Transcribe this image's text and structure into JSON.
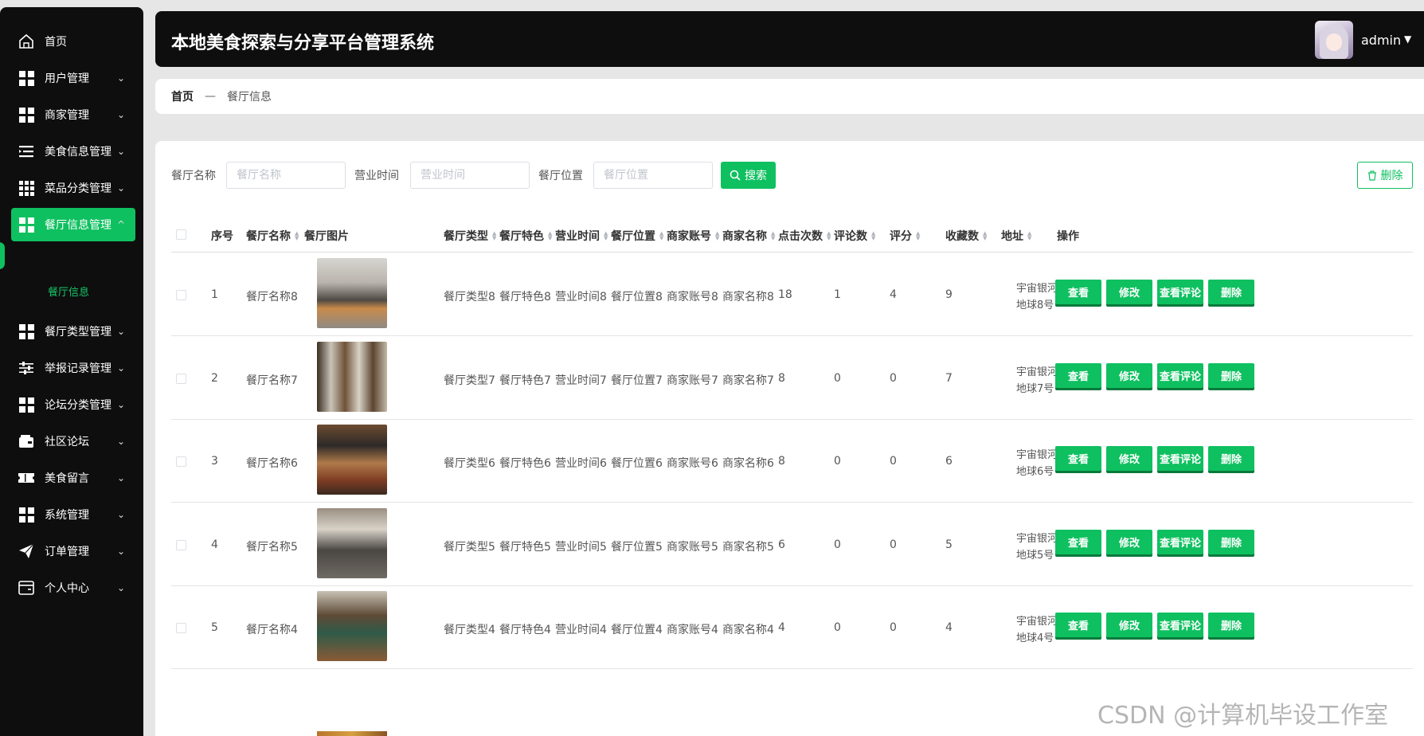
{
  "sidebar": {
    "items": [
      {
        "label": "首页",
        "icon": "home-icon"
      },
      {
        "label": "用户管理",
        "icon": "grid-icon"
      },
      {
        "label": "商家管理",
        "icon": "grid-icon"
      },
      {
        "label": "美食信息管理",
        "icon": "list-icon"
      },
      {
        "label": "菜品分类管理",
        "icon": "grid9-icon"
      },
      {
        "label": "餐厅信息管理",
        "icon": "grid-icon"
      },
      {
        "label": "餐厅类型管理",
        "icon": "grid-icon"
      },
      {
        "label": "举报记录管理",
        "icon": "sliders-icon"
      },
      {
        "label": "论坛分类管理",
        "icon": "grid-icon"
      },
      {
        "label": "社区论坛",
        "icon": "wallet-icon"
      },
      {
        "label": "美食留言",
        "icon": "ticket-icon"
      },
      {
        "label": "系统管理",
        "icon": "grid-icon"
      },
      {
        "label": "订单管理",
        "icon": "send-icon"
      },
      {
        "label": "个人中心",
        "icon": "card-icon"
      }
    ],
    "sub_item": "餐厅信息"
  },
  "header": {
    "title": "本地美食探索与分享平台管理系统",
    "user": "admin"
  },
  "breadcrumb": {
    "home": "首页",
    "sep": "—",
    "current": "餐厅信息"
  },
  "filters": {
    "name_label": "餐厅名称",
    "name_placeholder": "餐厅名称",
    "time_label": "营业时间",
    "time_placeholder": "营业时间",
    "location_label": "餐厅位置",
    "location_placeholder": "餐厅位置",
    "search_label": "搜索",
    "delete_label": "删除"
  },
  "table": {
    "headers": [
      "序号",
      "餐厅名称",
      "餐厅图片",
      "餐厅类型",
      "餐厅特色",
      "营业时间",
      "餐厅位置",
      "商家账号",
      "商家名称",
      "点击次数",
      "评论数",
      "评分",
      "收藏数",
      "地址",
      "操作"
    ],
    "actions": [
      "查看",
      "修改",
      "查看评论",
      "删除"
    ],
    "rows": [
      {
        "no": "1",
        "name": "餐厅名称8",
        "type": "餐厅类型8",
        "feature": "餐厅特色8",
        "time": "营业时间8",
        "location": "餐厅位置8",
        "account": "商家账号8",
        "merchant": "商家名称8",
        "clicks": "18",
        "comments": "1",
        "score": "4",
        "favorites": "9",
        "addr1": "宇宙银河系",
        "addr2": "地球8号"
      },
      {
        "no": "2",
        "name": "餐厅名称7",
        "type": "餐厅类型7",
        "feature": "餐厅特色7",
        "time": "营业时间7",
        "location": "餐厅位置7",
        "account": "商家账号7",
        "merchant": "商家名称7",
        "clicks": "8",
        "comments": "0",
        "score": "0",
        "favorites": "7",
        "addr1": "宇宙银河系",
        "addr2": "地球7号"
      },
      {
        "no": "3",
        "name": "餐厅名称6",
        "type": "餐厅类型6",
        "feature": "餐厅特色6",
        "time": "营业时间6",
        "location": "餐厅位置6",
        "account": "商家账号6",
        "merchant": "商家名称6",
        "clicks": "8",
        "comments": "0",
        "score": "0",
        "favorites": "6",
        "addr1": "宇宙银河系",
        "addr2": "地球6号"
      },
      {
        "no": "4",
        "name": "餐厅名称5",
        "type": "餐厅类型5",
        "feature": "餐厅特色5",
        "time": "营业时间5",
        "location": "餐厅位置5",
        "account": "商家账号5",
        "merchant": "商家名称5",
        "clicks": "6",
        "comments": "0",
        "score": "0",
        "favorites": "5",
        "addr1": "宇宙银河系",
        "addr2": "地球5号"
      },
      {
        "no": "5",
        "name": "餐厅名称4",
        "type": "餐厅类型4",
        "feature": "餐厅特色4",
        "time": "营业时间4",
        "location": "餐厅位置4",
        "account": "商家账号4",
        "merchant": "商家名称4",
        "clicks": "4",
        "comments": "0",
        "score": "0",
        "favorites": "4",
        "addr1": "宇宙银河系",
        "addr2": "地球4号"
      }
    ]
  },
  "watermark": "CSDN @计算机毕设工作室",
  "colors": {
    "accent": "#0fc060",
    "dark": "#0e0e0e"
  }
}
